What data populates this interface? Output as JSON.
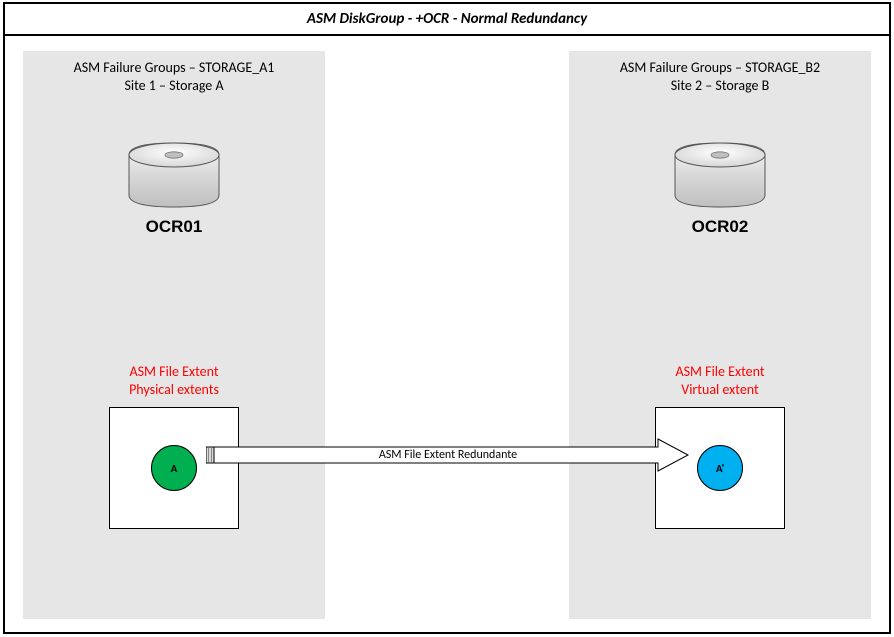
{
  "title": "ASM DiskGroup - +OCR -  Normal Redundancy",
  "failure_groups": {
    "left": {
      "header_line1": "ASM Failure Groups – STORAGE_A1",
      "header_line2": "Site 1 – Storage A",
      "disk_label": "OCR01",
      "extent_label_line1": "ASM File Extent",
      "extent_label_line2": "Physical extents",
      "circle_letter": "A"
    },
    "right": {
      "header_line1": "ASM Failure Groups – STORAGE_B2",
      "header_line2": "Site 2 – Storage B",
      "disk_label": "OCR02",
      "extent_label_line1": "ASM File Extent",
      "extent_label_line2": "Virtual extent",
      "circle_letter": "A'"
    }
  },
  "arrow_label": "ASM File Extent Redundante",
  "colors": {
    "physical_extent": "#00b050",
    "virtual_extent": "#00b0f0",
    "extent_text": "#ff0000",
    "panel_bg": "#e6e6e6"
  }
}
